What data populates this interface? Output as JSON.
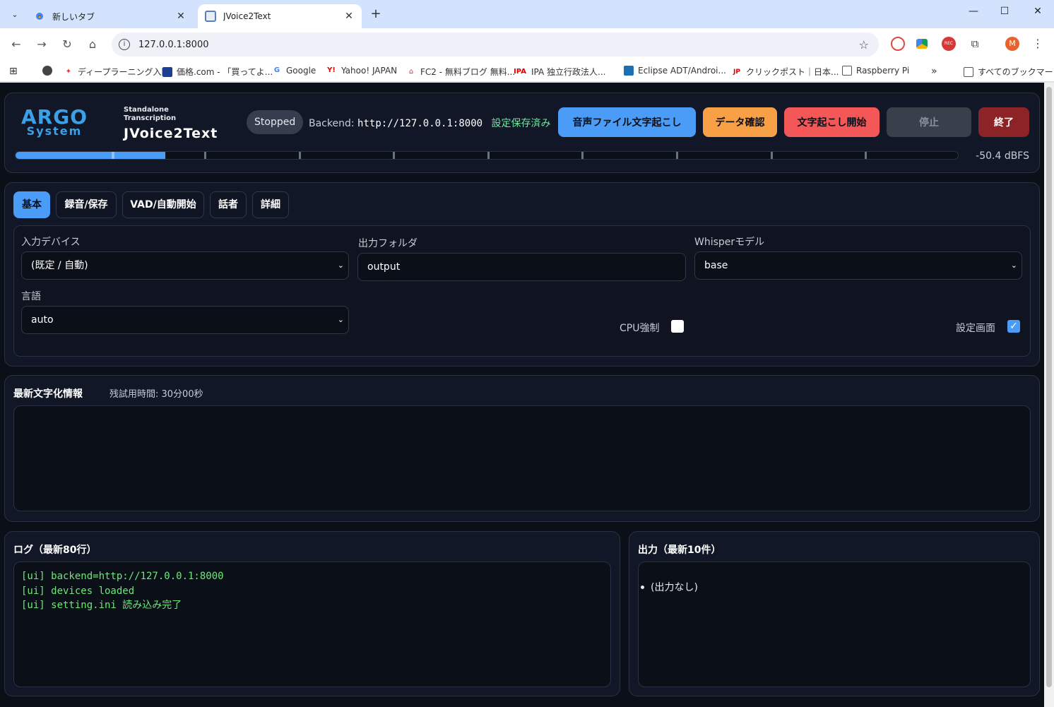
{
  "browser": {
    "tabs": [
      {
        "title": "新しいタブ",
        "active": false
      },
      {
        "title": "JVoice2Text",
        "active": true
      }
    ],
    "url": "127.0.0.1:8000",
    "profile_initial": "M",
    "ext_rec_label": "REC",
    "bookmarks": [
      "ディープラーニング入門",
      "価格.com - 「買ってよ...",
      "Google",
      "Yahoo! JAPAN",
      "FC2 - 無料ブログ 無料...",
      "IPA 独立行政法人...",
      "Eclipse ADT/Androi...",
      "クリックポスト｜日本...",
      "Raspberry Pi"
    ],
    "bookmark_icon_texts": [
      "Y!",
      "IPA"
    ],
    "bookmarks_overflow": "»",
    "all_bookmarks": "すべてのブックマーク"
  },
  "header": {
    "logo_line1": "ARGO",
    "logo_line2": "System",
    "subtitle_line1": "Standalone",
    "subtitle_line2": "Transcription",
    "app_name": "JVoice2Text",
    "status": "Stopped",
    "backend_label": "Backend:",
    "backend_url": "http://127.0.0.1:8000",
    "saved_text": "設定保存済み",
    "buttons": {
      "file_transcribe": "音声ファイル文字起こし",
      "data_check": "データ確認",
      "start": "文字起こし開始",
      "stop": "停止",
      "exit": "終了"
    },
    "colors": {
      "file_transcribe": "#4a9cf6",
      "data_check": "#f7a046",
      "start": "#f35757",
      "stop": "#3a404b",
      "exit": "#8c2326"
    },
    "meter_level": 0.159,
    "meter_peak": 0.102,
    "level_db": "-50.4 dBFS"
  },
  "settings": {
    "tabs": [
      "基本",
      "録音/保存",
      "VAD/自動開始",
      "話者",
      "詳細"
    ],
    "active_tab": 0,
    "input_device_label": "入力デバイス",
    "input_device_value": "(既定 / 自動)",
    "output_folder_label": "出力フォルダ",
    "output_folder_value": "output",
    "model_label": "Whisperモデル",
    "model_value": "base",
    "language_label": "言語",
    "language_value": "auto",
    "cpu_force_label": "CPU強制",
    "cpu_force_checked": false,
    "settings_screen_label": "設定画面",
    "settings_screen_checked": true
  },
  "latest": {
    "title": "最新文字化情報",
    "trial_time": "残試用時間: 30分00秒"
  },
  "log": {
    "title": "ログ（最新80行）",
    "lines": [
      "[ui] backend=http://127.0.0.1:8000",
      "[ui] devices loaded",
      "[ui] setting.ini 読み込み完了"
    ]
  },
  "output": {
    "title": "出力（最新10件）",
    "items": [
      "(出力なし)"
    ]
  }
}
